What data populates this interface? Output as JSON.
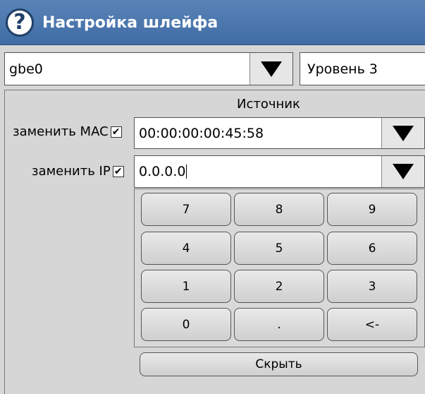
{
  "window": {
    "title": "Настройка шлейфа",
    "help_icon": "?"
  },
  "interface_select": {
    "value": "gbe0"
  },
  "level_select": {
    "value": "Уровень 3"
  },
  "source": {
    "heading": "Источник",
    "mac": {
      "label": "заменить MAC",
      "checked": true,
      "value": "00:00:00:00:45:58"
    },
    "ip": {
      "label": "заменить IP",
      "checked": true,
      "value": "0.0.0.0"
    }
  },
  "keypad": {
    "keys": [
      "7",
      "8",
      "9",
      "4",
      "5",
      "6",
      "1",
      "2",
      "3",
      "0",
      ".",
      "<-"
    ]
  },
  "hide_button": {
    "label": "Скрыть"
  }
}
